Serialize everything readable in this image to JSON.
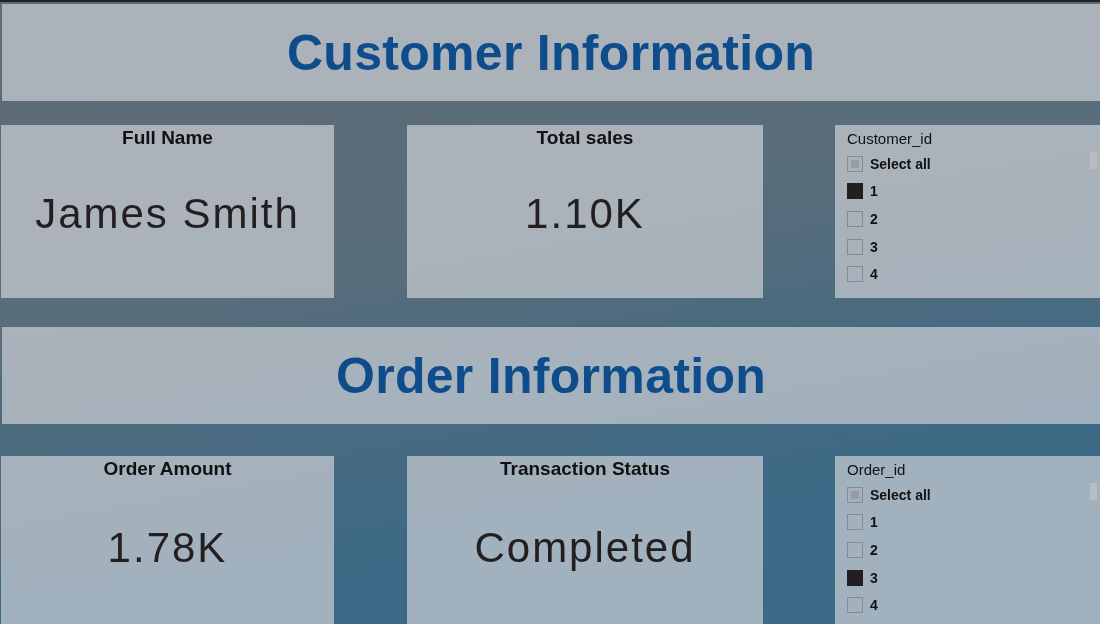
{
  "sections": [
    {
      "title": "Customer Information",
      "cards": [
        {
          "label": "Full Name",
          "value": "James Smith"
        },
        {
          "label": "Total sales",
          "value": "1.10K"
        }
      ],
      "slicer": {
        "field": "Customer_id",
        "select_all": {
          "label": "Select all",
          "checked": false,
          "indeterminate": true
        },
        "items": [
          {
            "label": "1",
            "checked": true
          },
          {
            "label": "2",
            "checked": false
          },
          {
            "label": "3",
            "checked": false
          },
          {
            "label": "4",
            "checked": false
          }
        ]
      }
    },
    {
      "title": "Order Information",
      "cards": [
        {
          "label": "Order Amount",
          "value": "1.78K"
        },
        {
          "label": "Transaction Status",
          "value": "Completed"
        }
      ],
      "slicer": {
        "field": "Order_id",
        "select_all": {
          "label": "Select all",
          "checked": false,
          "indeterminate": true
        },
        "items": [
          {
            "label": "1",
            "checked": false
          },
          {
            "label": "2",
            "checked": false
          },
          {
            "label": "3",
            "checked": true
          },
          {
            "label": "4",
            "checked": false
          }
        ]
      }
    }
  ]
}
